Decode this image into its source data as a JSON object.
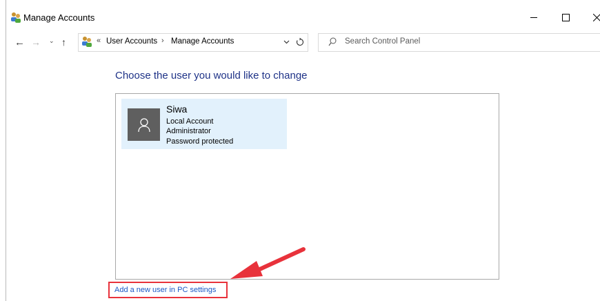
{
  "window": {
    "title": "Manage Accounts",
    "controls": {
      "minimize": "minimize",
      "maximize": "maximize",
      "close": "×"
    }
  },
  "nav": {
    "chevron": "«",
    "breadcrumb": [
      "User Accounts",
      "Manage Accounts"
    ],
    "separator": "›",
    "search_placeholder": "Search Control Panel"
  },
  "main": {
    "heading": "Choose the user you would like to change",
    "account": {
      "name": "Siwa",
      "type": "Local Account",
      "role": "Administrator",
      "status": "Password protected"
    },
    "add_link": "Add a new user in PC settings"
  },
  "colors": {
    "heading": "#1e3287",
    "tile_bg": "#e2f1fc",
    "link": "#1b58c6",
    "annotation_red": "#e8323b"
  },
  "icons": [
    "users-icon",
    "back-arrow-icon",
    "forward-arrow-icon",
    "recent-locations-icon",
    "up-arrow-icon",
    "dropdown-icon",
    "refresh-icon",
    "search-icon",
    "user-avatar-icon"
  ]
}
